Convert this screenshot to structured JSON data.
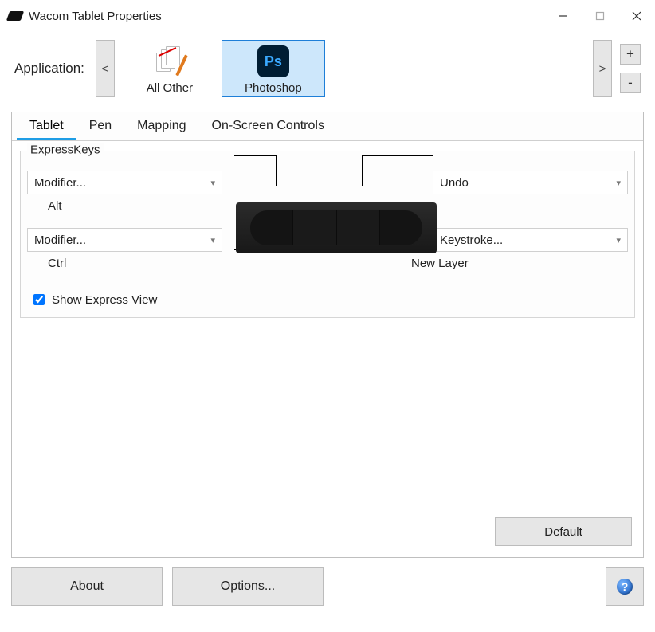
{
  "window": {
    "title": "Wacom Tablet Properties"
  },
  "app_row": {
    "label": "Application:",
    "prev": "<",
    "next": ">",
    "plus": "+",
    "minus": "-",
    "items": [
      {
        "name": "All Other",
        "selected": false
      },
      {
        "name": "Photoshop",
        "selected": true
      }
    ]
  },
  "tabs": [
    {
      "label": "Tablet",
      "active": true
    },
    {
      "label": "Pen",
      "active": false
    },
    {
      "label": "Mapping",
      "active": false
    },
    {
      "label": "On-Screen Controls",
      "active": false
    }
  ],
  "expresskeys": {
    "title": "ExpressKeys",
    "top_left": {
      "option": "Modifier...",
      "value": "Alt"
    },
    "bottom_left": {
      "option": "Modifier...",
      "value": "Ctrl"
    },
    "top_right": {
      "option": "Undo",
      "value": ""
    },
    "bottom_right": {
      "option": "Keystroke...",
      "value": "New Layer"
    },
    "show_express_view_label": "Show Express View",
    "show_express_view_checked": true
  },
  "buttons": {
    "default": "Default",
    "about": "About",
    "options": "Options...",
    "help": "?"
  }
}
